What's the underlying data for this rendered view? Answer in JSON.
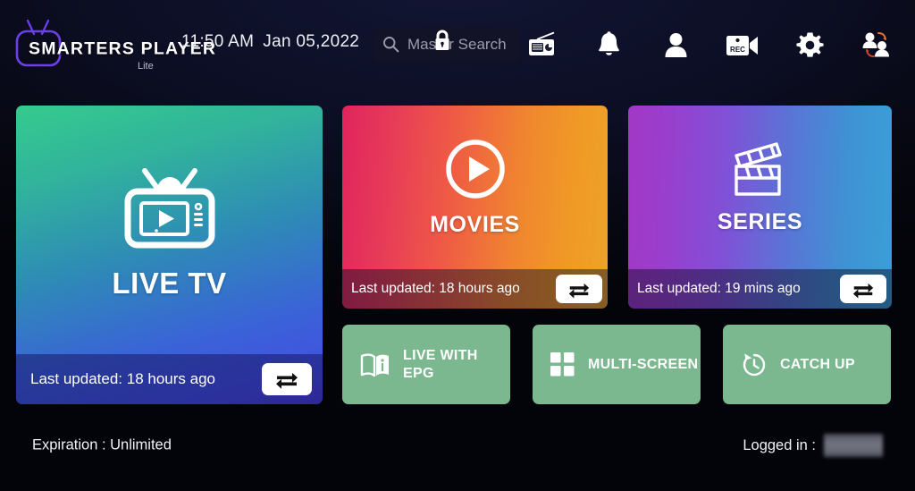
{
  "app": {
    "logo_text": "SMARTERS PLAYER",
    "logo_sub": "Lite",
    "logo_icon": "tv-antenna-icon",
    "accent_logo_color": "#6c3fe8"
  },
  "header": {
    "time": "11:50 AM",
    "date": "Jan 05,2022",
    "search": {
      "icon": "search-icon",
      "placeholder": "Master Search",
      "value": "",
      "lock_overlay_icon": "lock-icon"
    },
    "icons": [
      {
        "name": "radio-icon",
        "label": "Radio"
      },
      {
        "name": "bell-icon",
        "label": "Notifications"
      },
      {
        "name": "user-icon",
        "label": "Account"
      },
      {
        "name": "rec-camera-icon",
        "label": "Recordings"
      },
      {
        "name": "gear-icon",
        "label": "Settings"
      },
      {
        "name": "switch-user-icon",
        "label": "Switch User"
      }
    ]
  },
  "tiles": [
    {
      "id": "livetv",
      "title": "LIVE TV",
      "icon": "tv-play-icon",
      "updated": "Last updated: 18 hours ago",
      "refresh_icon": "refresh-loop-icon",
      "gradient_from": "#35cb8d",
      "gradient_to": "#4b3fd1"
    },
    {
      "id": "movies",
      "title": "MOVIES",
      "icon": "circle-play-icon",
      "updated": "Last updated: 18 hours ago",
      "refresh_icon": "refresh-loop-icon",
      "gradient_from": "#e0245e",
      "gradient_to": "#eda32a"
    },
    {
      "id": "series",
      "title": "SERIES",
      "icon": "clapperboard-icon",
      "updated": "Last updated: 19 mins ago",
      "refresh_icon": "refresh-loop-icon",
      "gradient_from": "#a238c6",
      "gradient_to": "#3a9fd6"
    }
  ],
  "quick_buttons": [
    {
      "id": "epg",
      "label": "LIVE WITH EPG",
      "icon": "book-info-icon",
      "color": "#7bb88f"
    },
    {
      "id": "multi",
      "label": "MULTI-SCREEN",
      "icon": "grid-four-icon",
      "color": "#7bb88f"
    },
    {
      "id": "catch",
      "label": "CATCH UP",
      "icon": "clock-back-icon",
      "color": "#7bb88f"
    }
  ],
  "footer": {
    "expiration": "Expiration : Unlimited",
    "logged_in_label": "Logged in :",
    "logged_in_value": ""
  }
}
